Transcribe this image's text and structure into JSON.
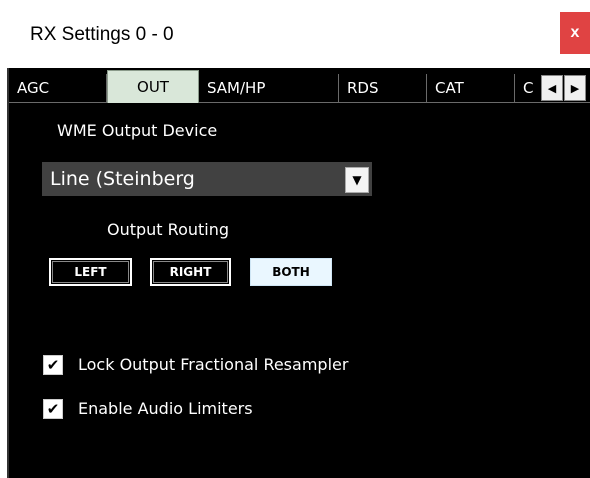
{
  "window": {
    "title": "RX Settings 0 - 0",
    "close_label": "x"
  },
  "tabs": [
    {
      "label": "AGC",
      "active": false
    },
    {
      "label": "OUT",
      "active": true
    },
    {
      "label": "SAM/HP",
      "active": false
    },
    {
      "label": "RDS",
      "active": false
    },
    {
      "label": "CAT",
      "active": false
    },
    {
      "label": "C",
      "active": false
    }
  ],
  "tab_scroll": {
    "left_glyph": "◀",
    "right_glyph": "▶"
  },
  "output_device": {
    "label": "WME Output Device",
    "selected": "Line (Steinberg",
    "arrow_glyph": "▼"
  },
  "routing": {
    "label": "Output Routing",
    "buttons": [
      {
        "label": "LEFT",
        "active": false
      },
      {
        "label": "RIGHT",
        "active": false
      },
      {
        "label": "BOTH",
        "active": true
      }
    ]
  },
  "options": [
    {
      "label": "Lock Output Fractional Resampler",
      "checked": true
    },
    {
      "label": "Enable Audio Limiters",
      "checked": true
    }
  ],
  "check_glyph": "✔"
}
